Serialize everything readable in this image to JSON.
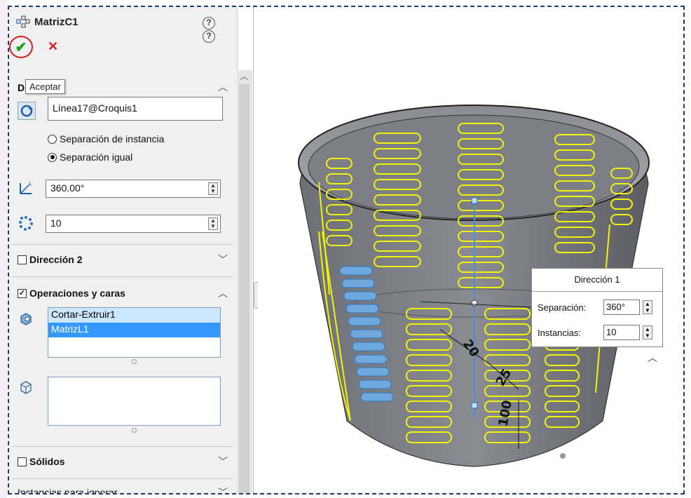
{
  "panel": {
    "title": "MatrizC1",
    "help_icon": "question-icon",
    "ok_tooltip": "Aceptar",
    "section1_letter": "D",
    "axis_field": "Línea17@Croquis1",
    "radio_instance_spacing": "Separación de instancia",
    "radio_equal_spacing": "Separación igual",
    "angle_value": "360.00°",
    "count_value": "10",
    "direction2_label": "Dirección 2",
    "features_label": "Operaciones y caras",
    "features_list": [
      "Cortar-Extruir1",
      "MatrizL1"
    ],
    "solids_label": "Sólidos",
    "skip_label": "Instancias para ignorar"
  },
  "popup": {
    "title": "Dirección 1",
    "spacing_label": "Separación:",
    "spacing_value": "360°",
    "instances_label": "Instancias:",
    "instances_value": "10"
  },
  "dimensions": [
    "20",
    "25",
    "100"
  ],
  "colors": {
    "accent_green": "#19a319",
    "cancel_red": "#d42020",
    "highlight_yellow": "#f2f20a",
    "selection_blue": "#3399ff",
    "frame_blue": "#1f3a7a"
  }
}
